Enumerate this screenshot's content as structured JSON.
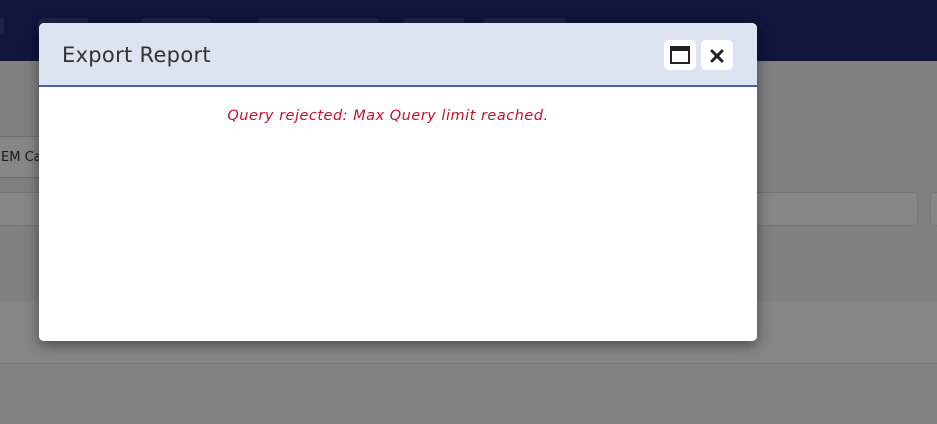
{
  "dialog": {
    "title": "Export Report",
    "message": "Query rejected: Max Query limit reached.",
    "maximize_icon": "window-maximize-icon",
    "close_icon": "close-icon"
  },
  "background": {
    "chip_label": "EM Ca"
  },
  "colors": {
    "nav": "#1c2872",
    "dialog_header": "#dee3f2",
    "header_border": "#4a5fa8",
    "error_text": "#c8102e"
  }
}
